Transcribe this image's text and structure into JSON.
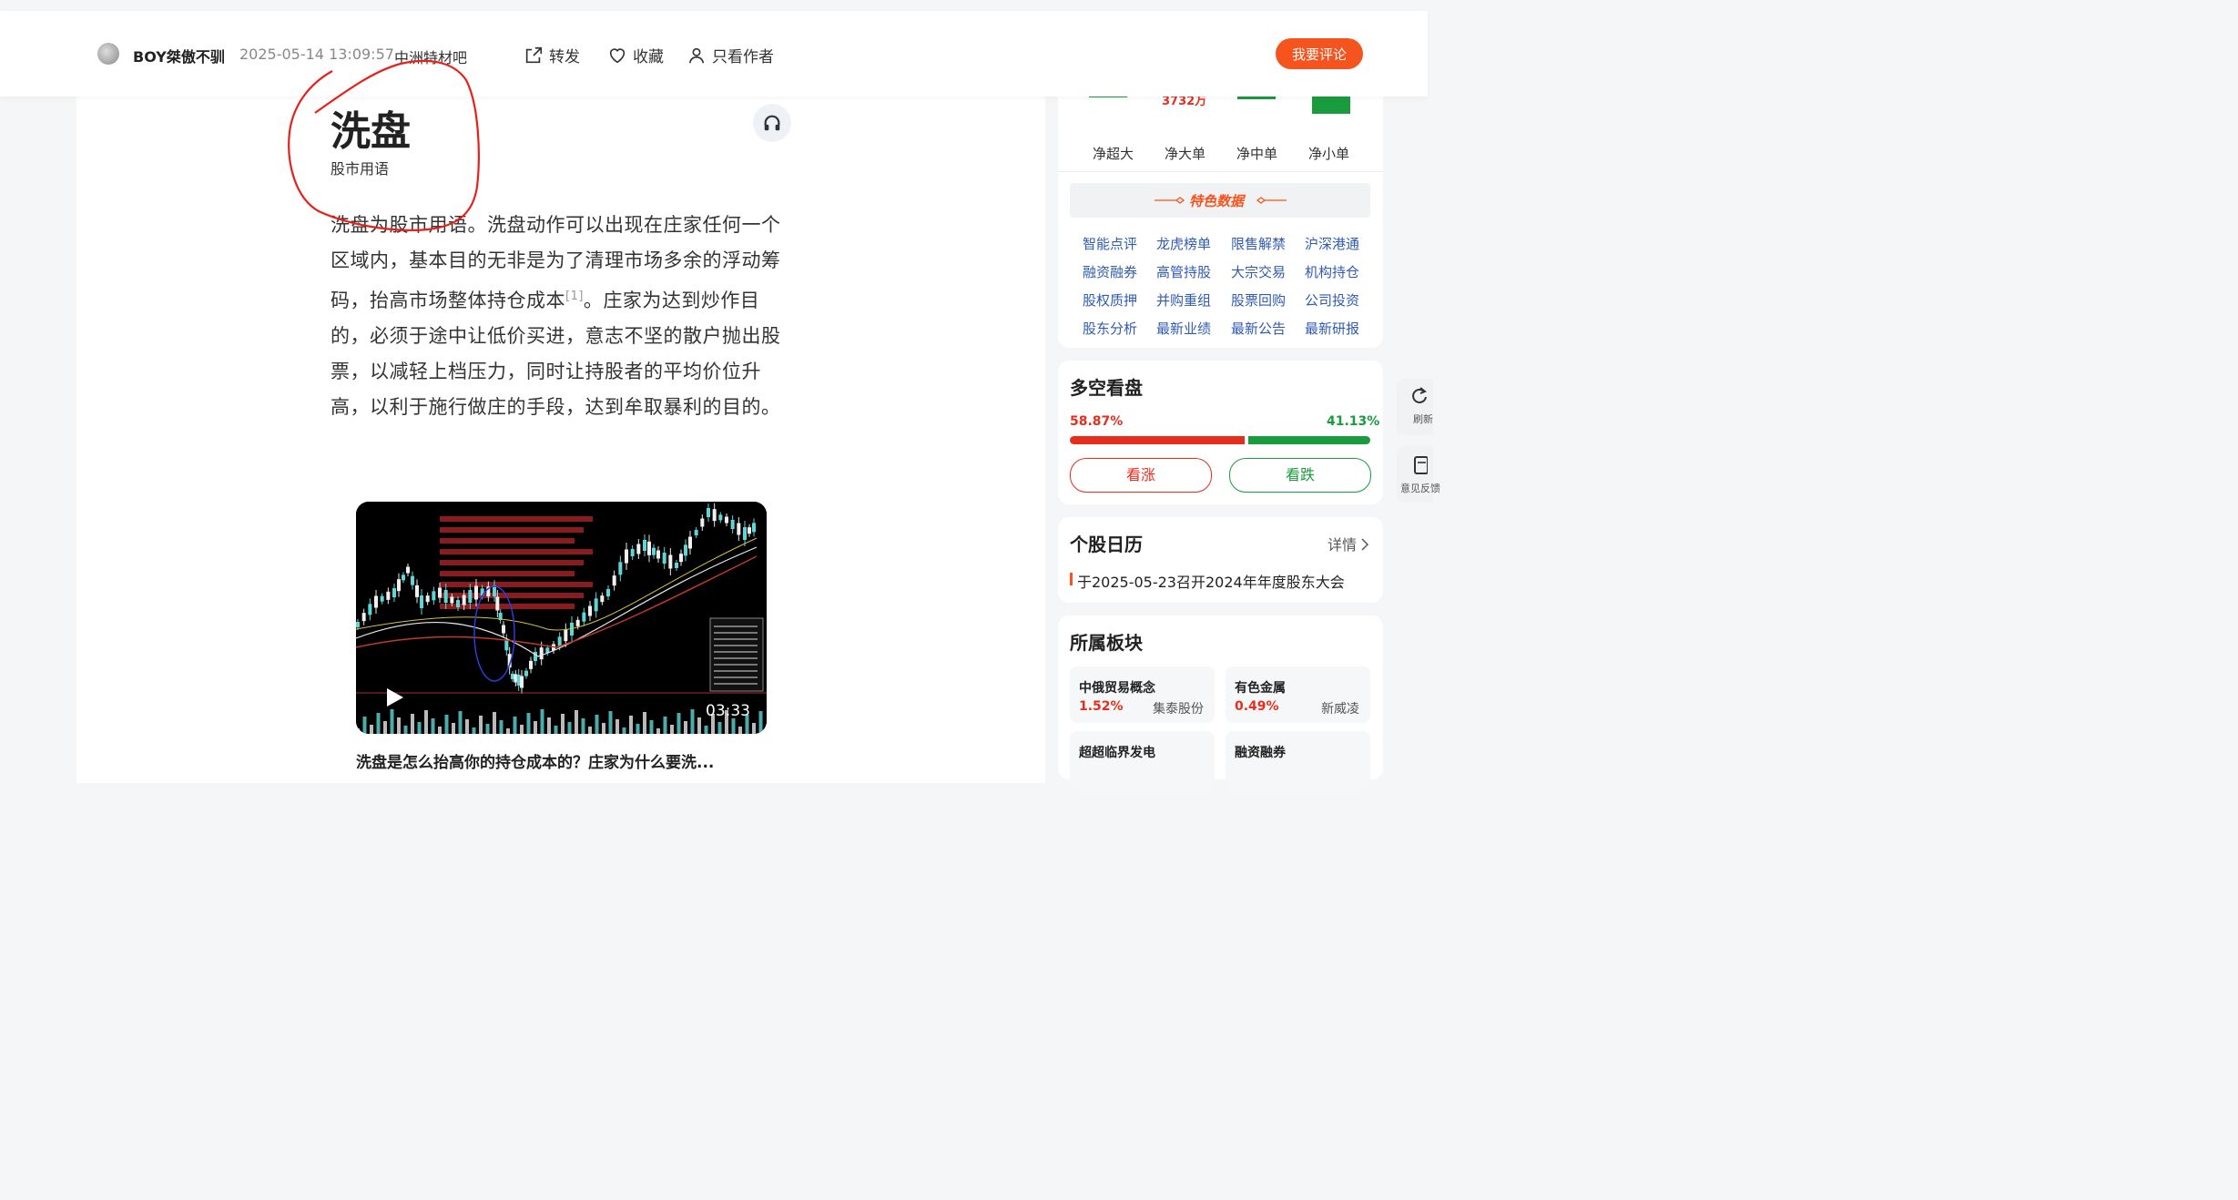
{
  "header": {
    "author": "BOY桀傲不驯",
    "time": "2025-05-14 13:09:57",
    "bar_name": "中洲特材吧",
    "share_label": "转发",
    "favorite_label": "收藏",
    "author_only_label": "只看作者",
    "comment_button": "我要评论"
  },
  "article": {
    "term": "洗盘",
    "term_category": "股市用语",
    "paragraph": "洗盘为股市用语。洗盘动作可以出现在庄家任何一个区域内，基本目的无非是为了清理市场多余的浮动筹码，抬高市场整体持仓成本",
    "citation": "[1]",
    "paragraph_rest": "。庄家为达到炒作目的，必须于途中让低价买进，意志不坚的散户抛出股票，以减轻上档压力，同时让持股者的平均价位升高，以利于施行做庄的手段，达到牟取暴利的目的。",
    "video": {
      "duration": "03:33",
      "title": "洗盘是怎么抬高你的持仓成本的？庄家为什么要洗..."
    }
  },
  "fund_flow": {
    "partial_value": "3732万",
    "labels": [
      "净超大",
      "净大单",
      "净中单",
      "净小单"
    ]
  },
  "features": {
    "title": "特色数据",
    "links": [
      [
        "智能点评",
        "龙虎榜单",
        "限售解禁",
        "沪深港通"
      ],
      [
        "融资融券",
        "高管持股",
        "大宗交易",
        "机构持仓"
      ],
      [
        "股权质押",
        "并购重组",
        "股票回购",
        "公司投资"
      ],
      [
        "股东分析",
        "最新业绩",
        "最新公告",
        "最新研报"
      ]
    ]
  },
  "long_short": {
    "title": "多空看盘",
    "bull_pct": "58.87%",
    "bear_pct": "41.13%",
    "bull_fraction": 0.5887,
    "bull_button": "看涨",
    "bear_button": "看跌"
  },
  "calendar": {
    "title": "个股日历",
    "more": "详情",
    "item": "于2025-05-23召开2024年年度股东大会"
  },
  "sectors": {
    "title": "所属板块",
    "items": [
      {
        "name": "中俄贸易概念",
        "pct": "1.52%",
        "stock": "集泰股份"
      },
      {
        "name": "有色金属",
        "pct": "0.49%",
        "stock": "新威凌"
      },
      {
        "name": "超超临界发电",
        "pct": "",
        "stock": ""
      },
      {
        "name": "融资融券",
        "pct": "",
        "stock": ""
      }
    ]
  },
  "float_buttons": {
    "refresh": "刷新",
    "feedback": "意见反馈"
  },
  "colors": {
    "accent": "#f5541f",
    "up": "#e62e1f",
    "down": "#1a9b3e",
    "link": "#2f5bb0"
  }
}
